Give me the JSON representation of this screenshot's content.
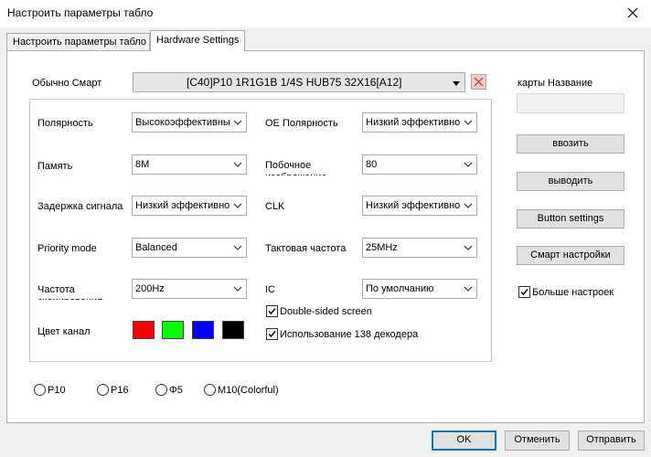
{
  "window": {
    "title": "Настроить параметры табло",
    "close_icon": "close-icon"
  },
  "tabs": [
    {
      "label": "Настроить параметры табло",
      "active": false
    },
    {
      "label": "Hardware Settings",
      "active": true
    }
  ],
  "smart": {
    "label": "Обычно Смарт",
    "selected": "[C40]P10  1R1G1B   1/4S  HUB75  32X16[A12]"
  },
  "card": {
    "label": "карты Название",
    "value": ""
  },
  "fields": {
    "polarity": {
      "label": "Полярность",
      "value": "Высокоэффективны"
    },
    "oe_polarity": {
      "label": "OE Полярность",
      "value": "Низкий эффективно"
    },
    "memory": {
      "label": "Память",
      "value": "8M"
    },
    "side_image": {
      "label": "Побочное изображение",
      "value": "80"
    },
    "signal_delay": {
      "label": "Задержка сигнала",
      "value": "Низкий эффективно"
    },
    "clk": {
      "label": "CLK",
      "value": "Низкий эффективно"
    },
    "priority_mode": {
      "label": "Priority mode",
      "value": "Balanced"
    },
    "clock_freq": {
      "label": "Тактовая частота",
      "value": "25MHz"
    },
    "scan_freq": {
      "label": "Частота сканирования",
      "value": "200Hz"
    },
    "ic": {
      "label": "IC",
      "value": "По умолчанию"
    }
  },
  "checkboxes": {
    "double_sided": {
      "label": "Double-sided screen",
      "checked": true
    },
    "decoder_138": {
      "label": "Использование 138 декодера",
      "checked": true
    },
    "more_settings": {
      "label": "Больше настроек",
      "checked": true
    }
  },
  "color_channel": {
    "label": "Цвет канал",
    "colors": [
      "#ff0000",
      "#00ff00",
      "#0000ff",
      "#000000"
    ]
  },
  "side_buttons": {
    "input": "ввозить",
    "output": "выводить",
    "button_settings": "Button settings",
    "smart_settings": "Смарт настройки"
  },
  "radios": [
    {
      "label": "P10",
      "selected": false
    },
    {
      "label": "P16",
      "selected": false
    },
    {
      "label": "Φ5",
      "selected": false
    },
    {
      "label": "M10(Colorful)",
      "selected": false
    }
  ],
  "footer": {
    "ok": "OK",
    "cancel": "Отменить",
    "send": "Отправить"
  }
}
